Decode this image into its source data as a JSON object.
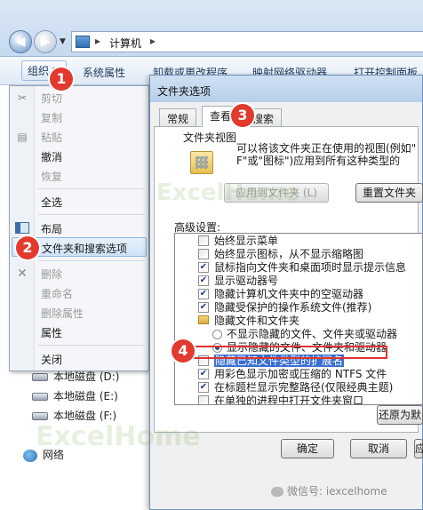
{
  "explorer": {
    "address": {
      "segments": [
        "计算机"
      ],
      "separator": "▸"
    },
    "toolbar": {
      "organize": "组织 ▼",
      "items": [
        "系统属性",
        "卸载或更改程序",
        "映射网络驱动器",
        "打开控制面板"
      ]
    },
    "drives": [
      "本地磁盘 (D:)",
      "本地磁盘 (E:)",
      "本地磁盘 (F:)"
    ],
    "network": "网络"
  },
  "context_menu": {
    "items": [
      {
        "label": "剪切",
        "icon": "scissors-icon",
        "disabled": true
      },
      {
        "label": "复制",
        "icon": "",
        "disabled": true
      },
      {
        "label": "粘贴",
        "icon": "clipboard-icon",
        "disabled": true
      },
      {
        "label": "撤消",
        "icon": "",
        "disabled": false
      },
      {
        "label": "恢复",
        "icon": "",
        "disabled": true
      },
      {
        "label": "全选",
        "icon": "",
        "disabled": false
      },
      {
        "label": "布局",
        "icon": "layout-icon",
        "disabled": false
      },
      {
        "label": "文件夹和搜索选项",
        "icon": "",
        "disabled": false,
        "highlighted": true
      },
      {
        "label": "删除",
        "icon": "delete-x-icon",
        "disabled": true
      },
      {
        "label": "重命名",
        "icon": "",
        "disabled": true
      },
      {
        "label": "删除属性",
        "icon": "",
        "disabled": true
      },
      {
        "label": "属性",
        "icon": "",
        "disabled": false
      },
      {
        "label": "关闭",
        "icon": "",
        "disabled": false
      }
    ]
  },
  "dialog": {
    "title": "文件夹选项",
    "tabs": [
      "常规",
      "查看",
      "搜索"
    ],
    "active_tab": "查看",
    "folder_views": {
      "title": "文件夹视图",
      "desc_line1": "可以将该文件夹正在使用的视图(例如\"",
      "desc_line2": "\"或\"图标\")应用到所有这种类型的",
      "desc_prefix": "F信",
      "apply_button": "应用到文件夹 (L)",
      "reset_button": "重置文件夹"
    },
    "advanced_label": "高级设置:",
    "settings": [
      {
        "type": "check",
        "checked": false,
        "label": "始终显示菜单"
      },
      {
        "type": "check",
        "checked": false,
        "label": "始终显示图标，从不显示缩略图"
      },
      {
        "type": "check",
        "checked": true,
        "label": "鼠标指向文件夹和桌面项时显示提示信息"
      },
      {
        "type": "check",
        "checked": true,
        "label": "显示驱动器号"
      },
      {
        "type": "check",
        "checked": true,
        "label": "隐藏计算机文件夹中的空驱动器"
      },
      {
        "type": "check",
        "checked": true,
        "label": "隐藏受保护的操作系统文件(推荐)"
      },
      {
        "type": "folder",
        "label": "隐藏文件和文件夹"
      },
      {
        "type": "radio",
        "checked": false,
        "label": "不显示隐藏的文件、文件夹或驱动器"
      },
      {
        "type": "radio",
        "checked": true,
        "label": "显示隐藏的文件、文件夹和驱动器"
      },
      {
        "type": "check",
        "checked": false,
        "label": "隐藏已知文件类型的扩展名",
        "highlighted": true
      },
      {
        "type": "check",
        "checked": true,
        "label": "用彩色显示加密或压缩的 NTFS 文件"
      },
      {
        "type": "check",
        "checked": true,
        "label": "在标题栏显示完整路径(仅限经典主题)"
      },
      {
        "type": "check",
        "checked": false,
        "label": "在单独的进程中打开文件夹窗口"
      }
    ],
    "restore_button": "还原为默",
    "ok_button": "确定",
    "cancel_button": "取消",
    "apply_button": "应"
  },
  "badges": [
    "1",
    "2",
    "3",
    "4"
  ],
  "watermark": {
    "text_excel": "Excel",
    "text_home": "Home"
  },
  "wechat": {
    "text": "微信号: iexcelhome",
    "icon": "wechat-icon"
  },
  "colors": {
    "badge": "#e23a2e",
    "highlight_box": "#e0322f",
    "menu_highlight": "#cfe3f7"
  }
}
